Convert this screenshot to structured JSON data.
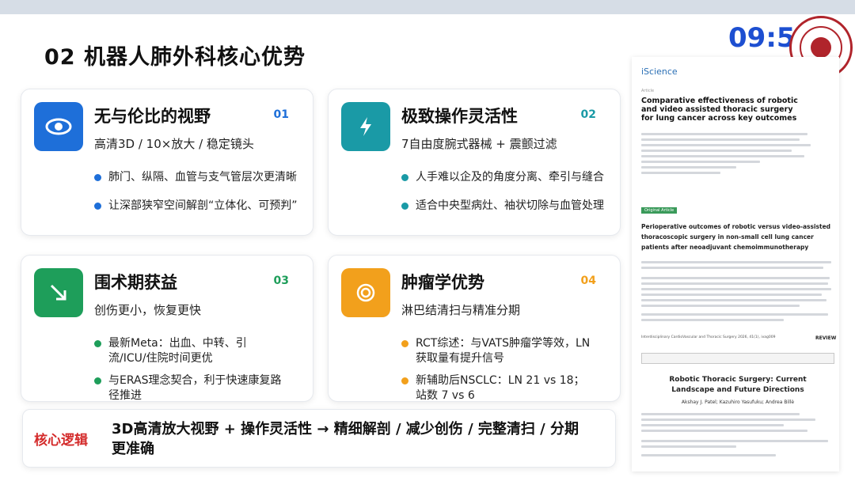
{
  "title": "02 机器人肺外科核心优势",
  "clock": "09:58",
  "cards": [
    {
      "title": "无与伦比的视野",
      "num": "01",
      "subtitle": "高清3D / 10×放大 / 稳定镜头",
      "icon": "eye-icon",
      "color": "#1e6fd9",
      "bullets": [
        "肺门、纵隔、血管与支气管层次更清晰",
        "让深部狭窄空间解剖“立体化、可预判”"
      ]
    },
    {
      "title": "极致操作灵活性",
      "num": "02",
      "subtitle": "7自由度腕式器械 + 震颤过滤",
      "icon": "lightning-icon",
      "color": "#1a9aa6",
      "bullets": [
        "人手难以企及的角度分离、牵引与缝合",
        "适合中央型病灶、袖状切除与血管处理"
      ]
    },
    {
      "title": "围术期获益",
      "num": "03",
      "subtitle": "创伤更小，恢复更快",
      "icon": "arrow-down-right-icon",
      "color": "#1e9e5a",
      "bullets": [
        "最新Meta：出血、中转、引流/ICU/住院时间更优",
        "与ERAS理念契合，利于快速康复路径推进"
      ]
    },
    {
      "title": "肿瘤学优势",
      "num": "04",
      "subtitle": "淋巴结清扫与精准分期",
      "icon": "target-icon",
      "color": "#f2a01c",
      "bullets": [
        "RCT综述：与VATS肿瘤学等效，LN获取量有提升信号",
        "新辅助后NSCLC：LN 21 vs 18；站数 7 vs 6"
      ]
    }
  ],
  "core": {
    "label": "核心逻辑",
    "text": "3D高清放大视野 + 操作灵活性 → 精细解剖 / 减少创伤 / 完整清扫 / 分期更准确"
  },
  "papers": {
    "brand": "iScience",
    "tag": "Article",
    "p1_title": "Comparative effectiveness of robotic and video assisted thoracic surgery for lung cancer across key outcomes",
    "p2_badge": "Original Article",
    "p2_title": "Perioperative outcomes of robotic versus video-assisted thoracoscopic surgery in non-small cell lung cancer patients after neoadjuvant chemoimmunotherapy",
    "p2_journal": "Interdisciplinary CardioVascular and Thoracic Surgery 2026, 41(1), ivag009",
    "p2_review": "REVIEW",
    "p3_title": "Robotic Thoracic Surgery: Current Landscape and Future Directions",
    "p3_authors": "Akshay J. Patel; Kazuhiro Yasufuku; Andrea Billè"
  },
  "colors": {
    "accent": "#1d4fd1",
    "core_label": "#d42b2b"
  }
}
